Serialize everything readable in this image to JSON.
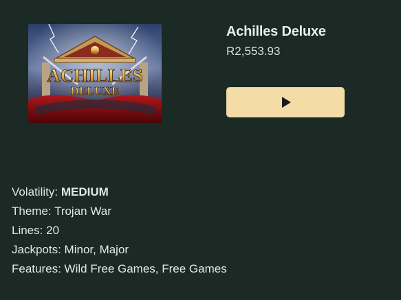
{
  "game": {
    "thumbnail": {
      "alt": "Achilles Deluxe",
      "logo_line1": "ACHILLES",
      "logo_line2": "DELUXE"
    },
    "title": "Achilles Deluxe",
    "price": "R2,553.93",
    "play_icon": "play-icon"
  },
  "details": {
    "volatility_label": "Volatility:",
    "volatility_value": "MEDIUM",
    "theme_label": "Theme:",
    "theme_value": "Trojan War",
    "lines_label": "Lines:",
    "lines_value": "20",
    "jackpots_label": "Jackpots:",
    "jackpots_value": "Minor, Major",
    "features_label": "Features:",
    "features_value": "Wild Free Games, Free Games"
  },
  "colors": {
    "background": "#1b2a24",
    "play_button": "#f3dca6",
    "text": "#e6ece6"
  }
}
